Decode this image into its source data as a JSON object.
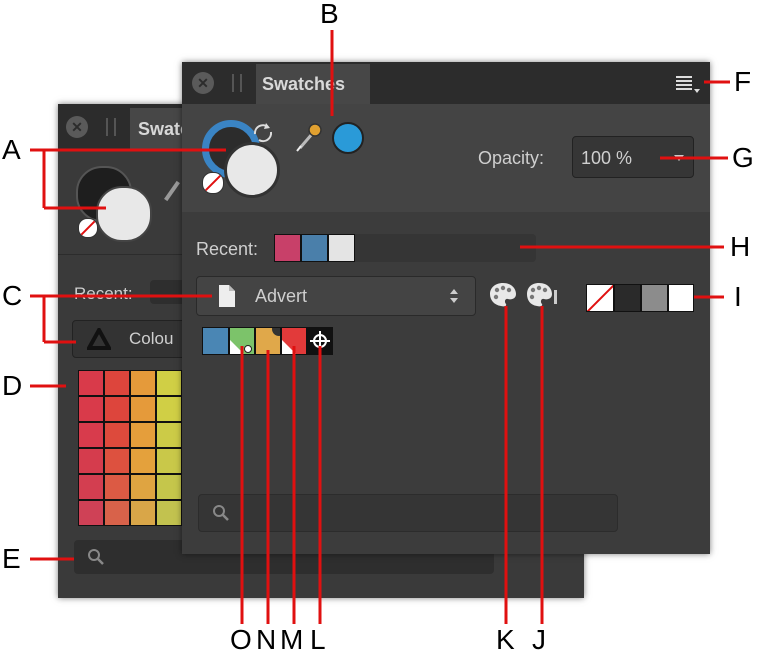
{
  "back_panel": {
    "tab_title": "Swatc",
    "recent_label": "Recent:",
    "category_label": "Colou",
    "search_icon": "search-icon",
    "grid_colors": [
      [
        "#d93a4a",
        "#dd453c",
        "#e59a3a",
        "#d0cf45"
      ],
      [
        "#d93a4a",
        "#dd453c",
        "#e59a3a",
        "#d0cf45"
      ],
      [
        "#d83b4c",
        "#dd4a3c",
        "#e59e3b",
        "#cccb47"
      ],
      [
        "#d53c4d",
        "#dd513f",
        "#e4a13c",
        "#c9c849"
      ],
      [
        "#d33e50",
        "#dc5a44",
        "#dfa441",
        "#c5c64b"
      ],
      [
        "#cf4156",
        "#d8624a",
        "#d9a648",
        "#c2c24f"
      ]
    ]
  },
  "front_panel": {
    "tab_title": "Swatches",
    "opacity_label": "Opacity:",
    "opacity_value": "100 %",
    "recent_label": "Recent:",
    "recent_colors": [
      "#c84069",
      "#4a7faa",
      "#e4e4e4"
    ],
    "palette_name": "Advert",
    "quick_colors": [
      "none",
      "#2a2a2a",
      "#8c8c8c",
      "#ffffff"
    ],
    "doc_swatches": [
      "#4a86b4",
      "#7cc36a",
      "#e0a84a",
      "#e23a3a",
      "#111111"
    ],
    "fill_color": "#1e8fd5",
    "ring_color": "#3a84c4",
    "stroke_fill": "#e8e8e8",
    "picker_color": "#2a9ad8"
  },
  "callouts": {
    "A": "A",
    "B": "B",
    "C": "C",
    "D": "D",
    "E": "E",
    "F": "F",
    "G": "G",
    "H": "H",
    "I": "I",
    "J": "J",
    "K": "K",
    "L": "L",
    "M": "M",
    "N": "N",
    "O": "O"
  },
  "accent_color": "#e01010"
}
